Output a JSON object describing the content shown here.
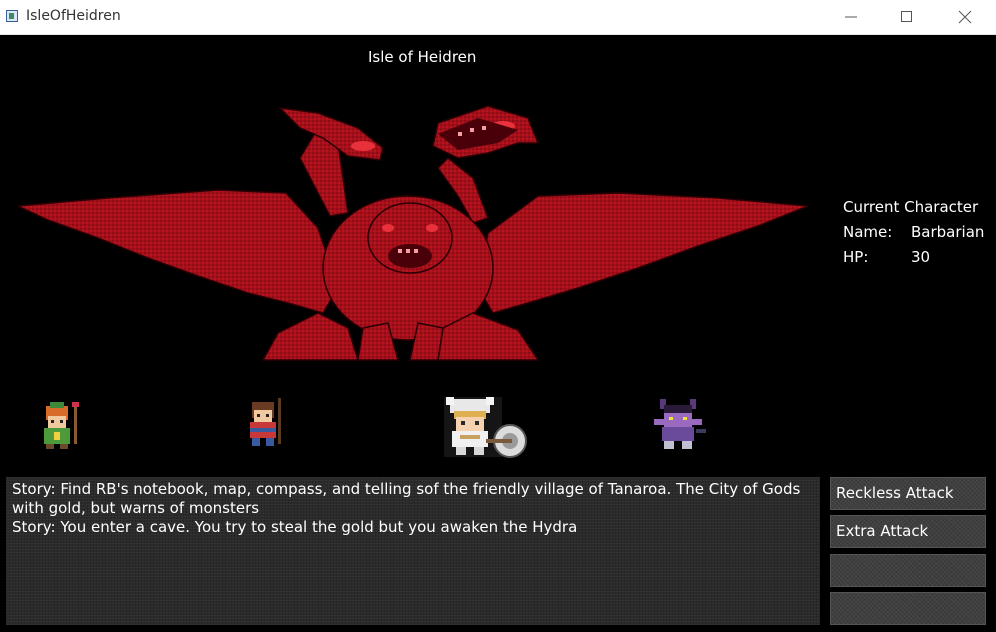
{
  "window": {
    "title": "IsleOfHeidren"
  },
  "game": {
    "title": "Isle of Heidren"
  },
  "current_character": {
    "heading": "Current Character",
    "name_label": "Name:",
    "name_value": "Barbarian",
    "hp_label": "HP:",
    "hp_value": "30"
  },
  "enemy": {
    "icon": "hydra-dragon-sprite",
    "color": "#a3101a"
  },
  "party": [
    {
      "icon": "druid-sprite"
    },
    {
      "icon": "archer-sprite"
    },
    {
      "icon": "barbarian-sprite"
    },
    {
      "icon": "tiefling-sprite"
    }
  ],
  "story": {
    "lines": [
      "Story: Find RB's notebook, map, compass, and telling sof the friendly village of Tanaroa. The City of Gods with gold, but warns of monsters",
      "Story: You enter a cave. You try to steal the gold but you awaken the Hydra"
    ]
  },
  "actions": [
    {
      "label": "Reckless Attack"
    },
    {
      "label": "Extra Attack"
    },
    {
      "label": ""
    },
    {
      "label": ""
    }
  ]
}
